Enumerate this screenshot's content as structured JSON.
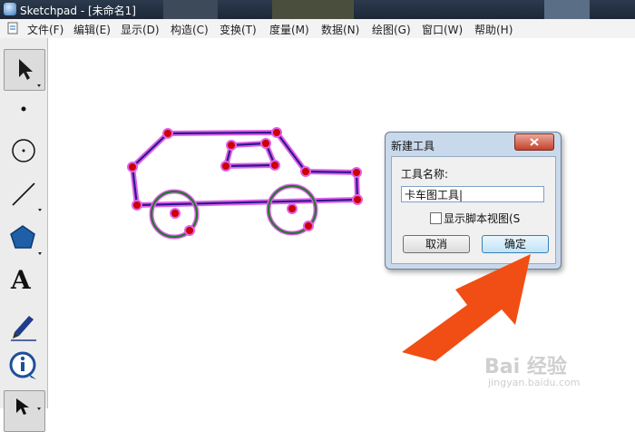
{
  "window": {
    "title": "Sketchpad  - [未命名1]"
  },
  "menu": [
    "文件(F)",
    "编辑(E)",
    "显示(D)",
    "构造(C)",
    "变换(T)",
    "度量(M)",
    "数据(N)",
    "绘图(G)",
    "窗口(W)",
    "帮助(H)"
  ],
  "toolbox": {
    "tools": [
      "arrow-select-icon",
      "point-icon",
      "compass-icon",
      "straightedge-icon",
      "polygon-icon",
      "text-icon",
      "marker-icon",
      "information-icon",
      "custom-tool-icon"
    ],
    "text_tool_glyph": "A"
  },
  "dialog": {
    "title": "新建工具",
    "name_label": "工具名称:",
    "name_value": "卡车图工具|",
    "show_script_label": "显示脚本视图(S",
    "show_script_checked": false,
    "cancel_label": "取消",
    "ok_label": "确定"
  },
  "watermark": {
    "text": "Bai 经验",
    "sub": "jingyan.baidu.com"
  },
  "colors": {
    "accent_arrow": "#f04e14",
    "point_fill": "#cc0000",
    "segment": "#2a1a8c",
    "highlight": "#e060e8",
    "circle": "#1f7a2a"
  }
}
